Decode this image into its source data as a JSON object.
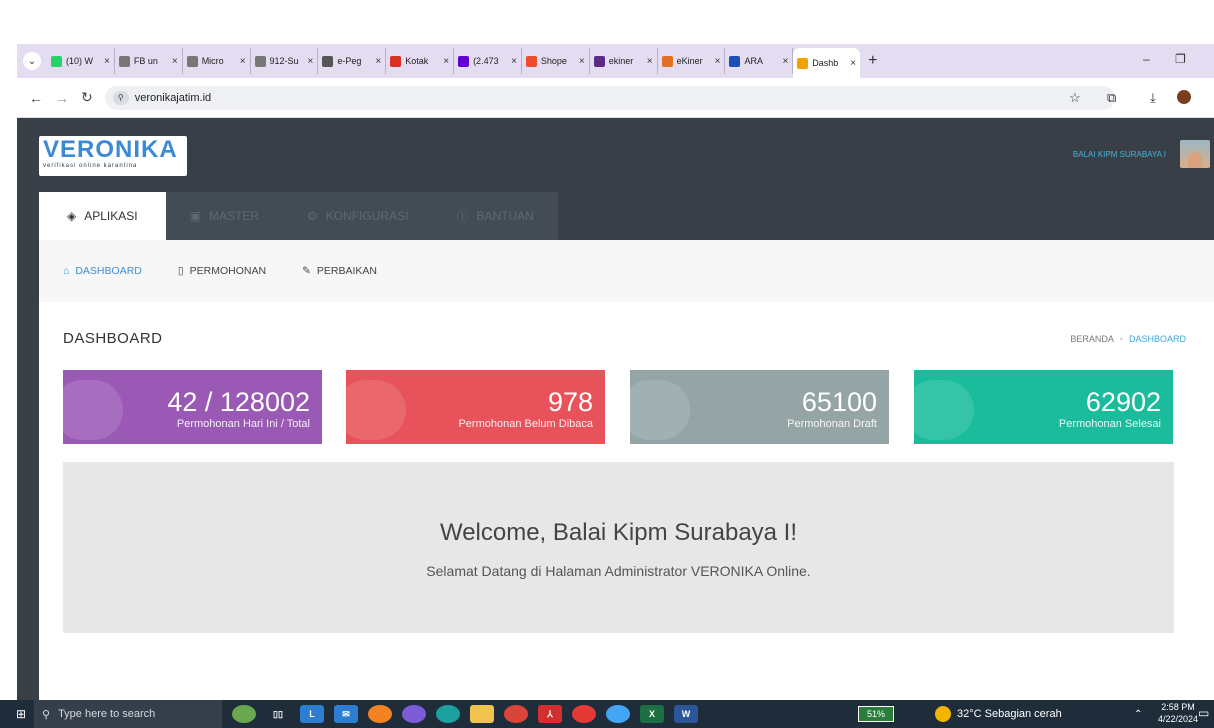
{
  "browser": {
    "tabs": [
      {
        "title": "(10) W",
        "color": "#25d366",
        "icon": "whatsapp-icon"
      },
      {
        "title": "FB un",
        "color": "#777777",
        "icon": "globe-icon"
      },
      {
        "title": "Micro",
        "color": "#777777",
        "icon": "globe-icon"
      },
      {
        "title": "912-Su",
        "color": "#777777",
        "icon": "globe-icon"
      },
      {
        "title": "e-Peg",
        "color": "#555555",
        "icon": "clock-icon"
      },
      {
        "title": "Kotak",
        "color": "#d93025",
        "icon": "gmail-icon"
      },
      {
        "title": "(2.473",
        "color": "#6001d2",
        "icon": "yahoo-mail-icon"
      },
      {
        "title": "Shope",
        "color": "#ee4d2d",
        "icon": "shopee-icon"
      },
      {
        "title": "ekiner",
        "color": "#5b2a86",
        "icon": "ekinerja-icon"
      },
      {
        "title": "eKiner",
        "color": "#e36f23",
        "icon": "ekinerja-dots-icon"
      },
      {
        "title": "ARA",
        "color": "#1e4fb5",
        "icon": "ara-icon"
      },
      {
        "title": "Dashb",
        "color": "#f4a100",
        "icon": "dashboard-favicon"
      }
    ],
    "close_glyph": "×",
    "new_tab": "+",
    "url": "veronikajatim.id"
  },
  "app": {
    "logo_title": "VERONIKA",
    "logo_sub": "verifikasi online karantina",
    "user": "BALAI KIPM SURABAYA I",
    "menu": [
      {
        "label": "APLIKASI",
        "icon": "◈"
      },
      {
        "label": "MASTER",
        "icon": "▣"
      },
      {
        "label": "KONFIGURASI",
        "icon": "⚙"
      },
      {
        "label": "BANTUAN",
        "icon": "ⓘ"
      }
    ],
    "subnav": [
      {
        "label": "DASHBOARD",
        "icon": "⌂"
      },
      {
        "label": "PERMOHONAN",
        "icon": "▯"
      },
      {
        "label": "PERBAIKAN",
        "icon": "✎"
      }
    ],
    "page_title": "DASHBOARD",
    "breadcrumb": {
      "home": "BERANDA",
      "sep": "•",
      "current": "DASHBOARD"
    },
    "stats": [
      {
        "value": "42 / 128002",
        "label": "Permohonan Hari Ini / Total",
        "color": "#9b59b6"
      },
      {
        "value": "978",
        "label": "Permohonan Belum Dibaca",
        "color": "#e8525a"
      },
      {
        "value": "65100",
        "label": "Permohonan Draft",
        "color": "#95a5a6"
      },
      {
        "value": "62902",
        "label": "Permohonan Selesai",
        "color": "#1abc9c"
      }
    ],
    "welcome_title": "Welcome, Balai Kipm Surabaya I!",
    "welcome_sub": "Selamat Datang di Halaman Administrator VERONIKA Online."
  },
  "taskbar": {
    "search_placeholder": "Type here to search",
    "battery": "51%",
    "weather": "32°C  Sebagian cerah",
    "time": "2:58 PM",
    "date": "4/22/2024"
  }
}
